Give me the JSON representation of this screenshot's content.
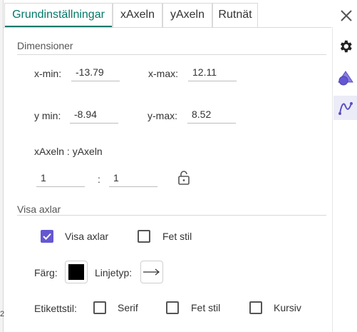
{
  "tabs": [
    {
      "label": "Grundinställningar",
      "active": true
    },
    {
      "label": "xAxeln",
      "active": false
    },
    {
      "label": "yAxeln",
      "active": false
    },
    {
      "label": "Rutnät",
      "active": false
    }
  ],
  "left_strip": {
    "mark": "2"
  },
  "dimensions": {
    "title": "Dimensioner",
    "xmin_label": "x-min:",
    "xmin_value": "-13.79",
    "xmax_label": "x-max:",
    "xmax_value": "12.11",
    "ymin_label": "y min:",
    "ymin_value": "-8.94",
    "ymax_label": "y-max:",
    "ymax_value": "8.52",
    "ratio_label": "xAxeln : yAxeln",
    "ratio_x": "1",
    "ratio_sep": ":",
    "ratio_y": "1"
  },
  "show_axes": {
    "title": "Visa axlar",
    "show_axes_label": "Visa axlar",
    "show_axes_checked": true,
    "bold_label": "Fet stil",
    "bold_checked": false,
    "color_label": "Färg:",
    "color_value": "#000000",
    "linetype_label": "Linjetyp:",
    "label_style_label": "Etikettstil:",
    "serif_label": "Serif",
    "serif_checked": false,
    "label_bold_label": "Fet stil",
    "label_bold_checked": false,
    "italic_label": "Kursiv",
    "italic_checked": false
  },
  "sidebar": {
    "icons": [
      "gear-icon",
      "shapes-icon",
      "graph-icon"
    ],
    "active_icon": "graph-icon"
  },
  "colors": {
    "accent": "#00796b",
    "checkbox": "#6557d2",
    "active_side": "#ececf8"
  }
}
